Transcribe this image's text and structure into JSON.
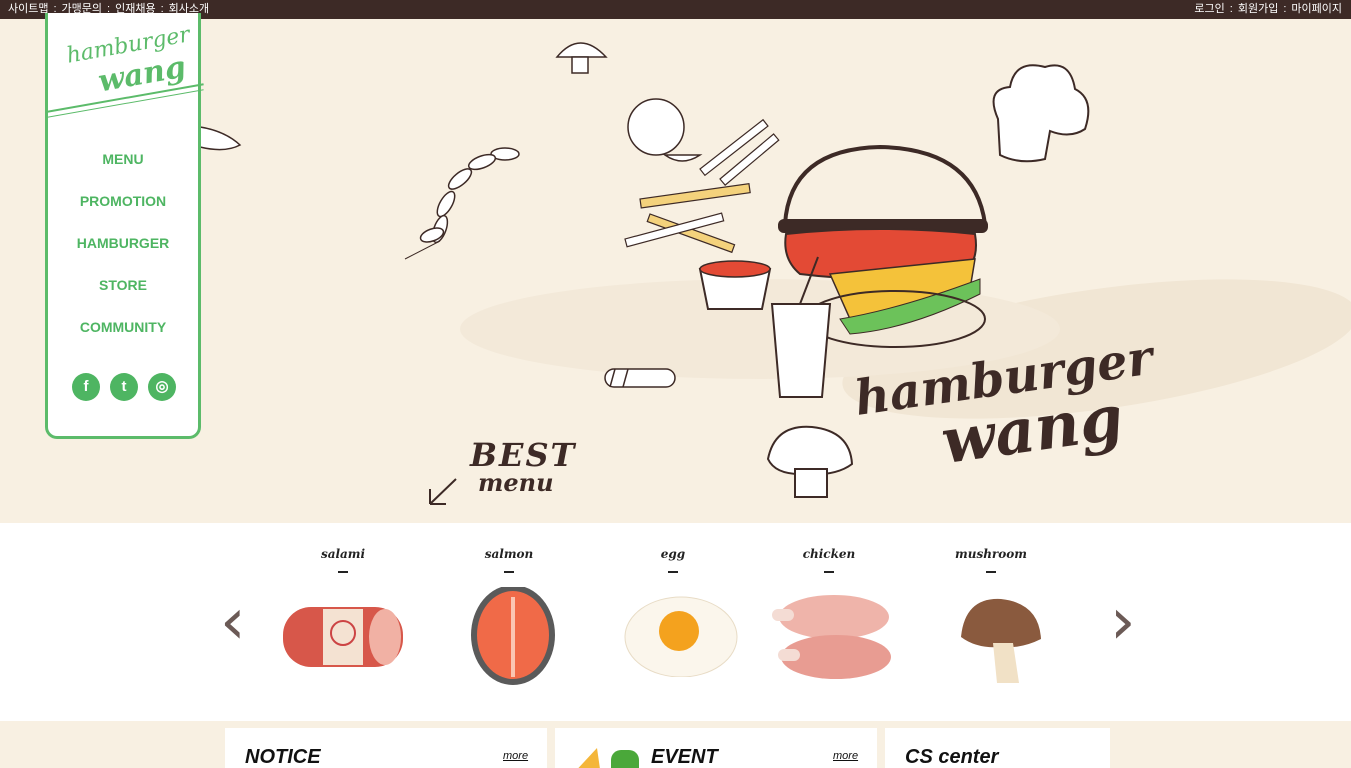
{
  "topbar": {
    "left_links": [
      "사이트맵",
      "가맹문의",
      "인재채용",
      "회사소개"
    ],
    "right_links": [
      "로그인",
      "회원가입",
      "마이페이지"
    ],
    "separator": ":"
  },
  "logo": {
    "line1": "hamburger",
    "line2": "wang"
  },
  "nav": {
    "items": [
      "MENU",
      "PROMOTION",
      "HAMBURGER",
      "STORE",
      "COMMUNITY"
    ]
  },
  "social": {
    "icons": [
      "facebook-icon",
      "twitter-icon",
      "instagram-icon"
    ]
  },
  "hero": {
    "best_line1": "BEST",
    "best_line2": "menu",
    "brand_line1": "hamburger",
    "brand_line2": "wang"
  },
  "ingredients": {
    "items": [
      "salami",
      "salmon",
      "egg",
      "chicken",
      "mushroom"
    ],
    "prev_icon": "chevron-left-icon",
    "next_icon": "chevron-right-icon"
  },
  "boxes": {
    "notice_title": "NOTICE",
    "notice_more": "more",
    "event_title": "EVENT",
    "event_more": "more",
    "cs_title": "CS center"
  },
  "colors": {
    "brand_green": "#5cbb6a",
    "topbar": "#3d2a26",
    "hero_bg": "#f8f0e2"
  }
}
